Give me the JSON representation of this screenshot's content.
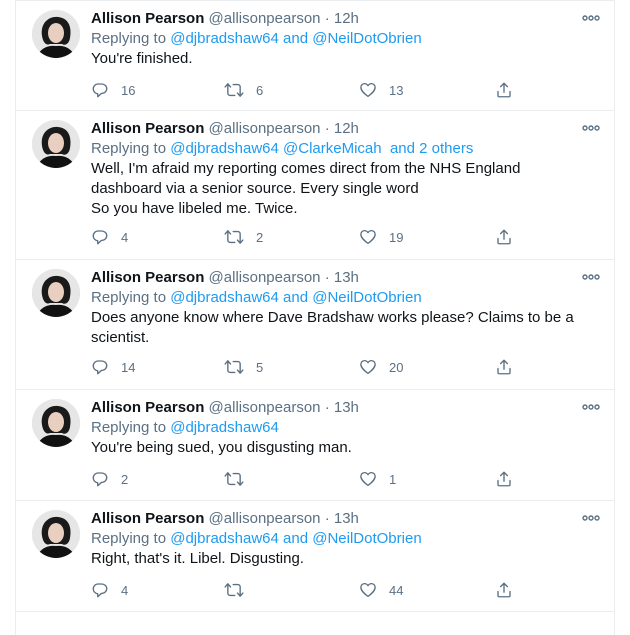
{
  "tweets": [
    {
      "name": "Allison Pearson",
      "handle": "@allisonpearson",
      "dot": "·",
      "time": "12h",
      "replying_prefix": "Replying to",
      "replying_parts": [
        "@djbradshaw64",
        " and ",
        "@NeilDotObrien"
      ],
      "text": "You're finished.",
      "replies": "16",
      "retweets": "6",
      "likes": "13"
    },
    {
      "name": "Allison Pearson",
      "handle": "@allisonpearson",
      "dot": "·",
      "time": "12h",
      "replying_prefix": "Replying to",
      "replying_parts": [
        "@djbradshaw64",
        " ",
        "@ClarkeMicah",
        "  and 2 others"
      ],
      "text": "Well, I'm afraid my reporting comes direct from the NHS England dashboard via a senior source. Every single word\n So you have libeled me. Twice.",
      "replies": "4",
      "retweets": "2",
      "likes": "19"
    },
    {
      "name": "Allison Pearson",
      "handle": "@allisonpearson",
      "dot": "·",
      "time": "13h",
      "replying_prefix": "Replying to",
      "replying_parts": [
        "@djbradshaw64",
        " and ",
        "@NeilDotObrien"
      ],
      "text": "Does anyone know where Dave Bradshaw works please? Claims to be a scientist.",
      "replies": "14",
      "retweets": "5",
      "likes": "20"
    },
    {
      "name": "Allison Pearson",
      "handle": "@allisonpearson",
      "dot": "·",
      "time": "13h",
      "replying_prefix": "Replying to",
      "replying_parts": [
        "@djbradshaw64"
      ],
      "text": "You're being sued, you disgusting man.",
      "replies": "2",
      "retweets": "",
      "likes": "1"
    },
    {
      "name": "Allison Pearson",
      "handle": "@allisonpearson",
      "dot": "·",
      "time": "13h",
      "replying_prefix": "Replying to",
      "replying_parts": [
        "@djbradshaw64",
        " and ",
        "@NeilDotObrien"
      ],
      "text": "Right, that's it. Libel. Disgusting.",
      "replies": "4",
      "retweets": "",
      "likes": "44"
    }
  ],
  "icons": {
    "more": "more-icon",
    "reply": "reply-icon",
    "retweet": "retweet-icon",
    "like": "heart-icon",
    "share": "share-icon"
  },
  "colors": {
    "mention": "#1d9bf0",
    "secondary": "#5b7083",
    "divider": "#ebeef0"
  }
}
